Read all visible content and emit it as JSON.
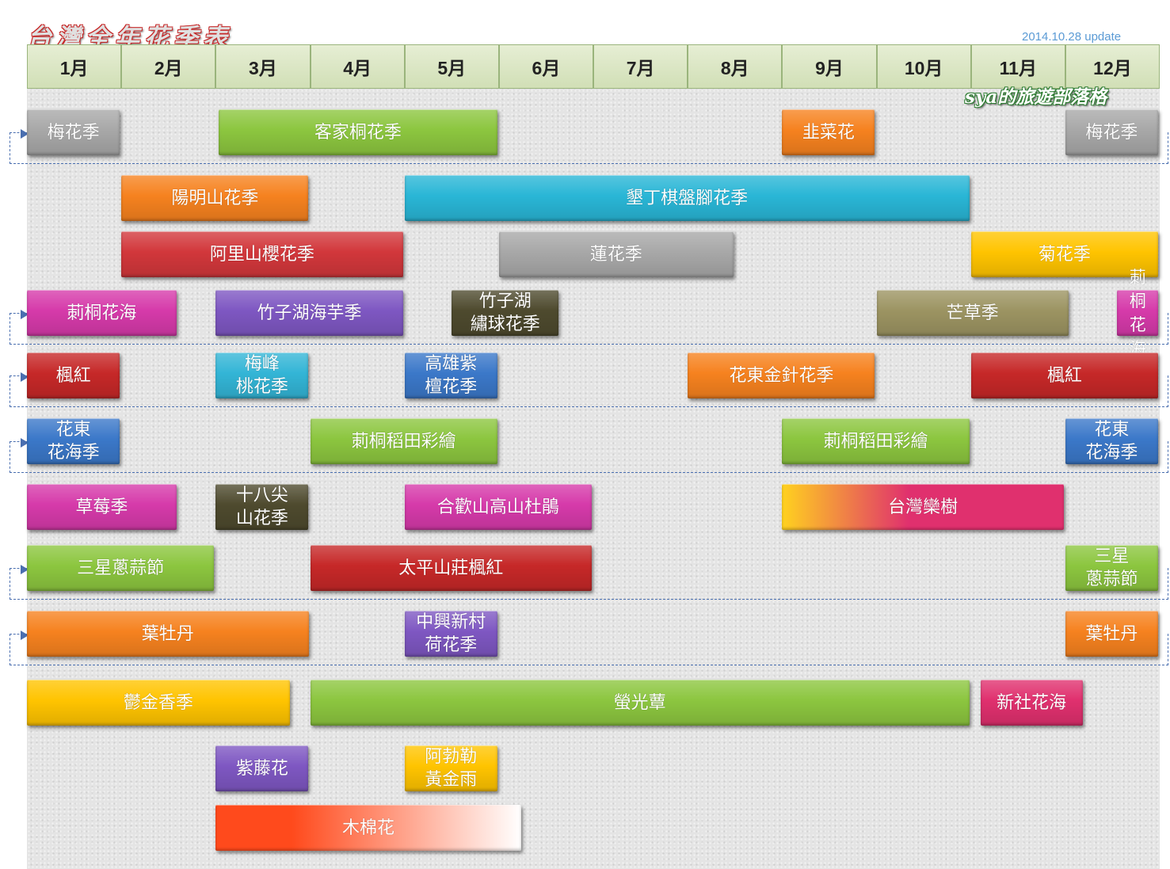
{
  "header": {
    "title": "台灣全年花季表",
    "update": "2014.10.28 update",
    "author": "sya的旅遊部落格"
  },
  "chart_data": {
    "type": "gantt",
    "title": "台灣全年花季表",
    "months": [
      "1月",
      "2月",
      "3月",
      "4月",
      "5月",
      "6月",
      "7月",
      "8月",
      "9月",
      "10月",
      "11月",
      "12月"
    ],
    "x_range": [
      1,
      13
    ],
    "rows": [
      {
        "row": 1,
        "wraps_year": true,
        "bars": [
          {
            "label": "梅花季",
            "start": 1.0,
            "end": 2.0,
            "color": "#a8a8a8"
          },
          {
            "label": "客家桐花季",
            "start": 3.03,
            "end": 6.0,
            "color": "#8cc63f"
          },
          {
            "label": "韭菜花",
            "start": 9.0,
            "end": 10.0,
            "color": "#f6821f"
          },
          {
            "label": "梅花季",
            "start": 12.0,
            "end": 13.0,
            "color": "#a8a8a8"
          }
        ]
      },
      {
        "row": 2,
        "wraps_year": false,
        "bars": [
          {
            "label": "陽明山花季",
            "start": 2.0,
            "end": 4.0,
            "color": "#f6821f"
          },
          {
            "label": "墾丁棋盤腳花季",
            "start": 5.0,
            "end": 11.0,
            "color": "#29b6d6"
          }
        ]
      },
      {
        "row": 3,
        "wraps_year": false,
        "bars": [
          {
            "label": "阿里山櫻花季",
            "start": 2.0,
            "end": 5.0,
            "color": "#d2373b"
          },
          {
            "label": "蓮花季",
            "start": 6.0,
            "end": 8.5,
            "color": "#a8a8a8"
          },
          {
            "label": "菊花季",
            "start": 11.0,
            "end": 13.0,
            "color": "#ffc400"
          }
        ]
      },
      {
        "row": 4,
        "wraps_year": true,
        "bars": [
          {
            "label": "莿桐花海",
            "start": 1.0,
            "end": 2.6,
            "color": "#d63aaa"
          },
          {
            "label": "竹子湖海芋季",
            "start": 3.0,
            "end": 5.0,
            "color": "#7e57c2"
          },
          {
            "label": "竹子湖\n繡球花季",
            "start": 5.5,
            "end": 6.65,
            "color": "#4e4a2e"
          },
          {
            "label": "芒草季",
            "start": 10.0,
            "end": 12.05,
            "color": "#9c9462"
          },
          {
            "label": "莿\n桐\n花\n海",
            "start": 12.55,
            "end": 13.0,
            "color": "#d63aaa",
            "vertical": true
          }
        ]
      },
      {
        "row": 5,
        "wraps_year": true,
        "bars": [
          {
            "label": "楓紅",
            "start": 1.0,
            "end": 2.0,
            "color": "#c62828"
          },
          {
            "label": "梅峰\n桃花季",
            "start": 3.0,
            "end": 4.0,
            "color": "#33b5d6"
          },
          {
            "label": "高雄紫\n檀花季",
            "start": 5.0,
            "end": 6.0,
            "color": "#3b78c9"
          },
          {
            "label": "花東金針花季",
            "start": 8.0,
            "end": 10.0,
            "color": "#f6821f"
          },
          {
            "label": "楓紅",
            "start": 11.0,
            "end": 13.0,
            "color": "#c62828"
          }
        ]
      },
      {
        "row": 6,
        "wraps_year": true,
        "bars": [
          {
            "label": "花東\n花海季",
            "start": 1.0,
            "end": 2.0,
            "color": "#3b78c9"
          },
          {
            "label": "莿桐稻田彩繪",
            "start": 4.0,
            "end": 6.0,
            "color": "#8cc63f"
          },
          {
            "label": "莿桐稻田彩繪",
            "start": 9.0,
            "end": 11.0,
            "color": "#8cc63f"
          },
          {
            "label": "花東\n花海季",
            "start": 12.0,
            "end": 13.0,
            "color": "#3b78c9"
          }
        ]
      },
      {
        "row": 7,
        "wraps_year": false,
        "bars": [
          {
            "label": "草莓季",
            "start": 1.0,
            "end": 2.6,
            "color": "#d63aaa"
          },
          {
            "label": "十八尖\n山花季",
            "start": 3.0,
            "end": 4.0,
            "color": "#4e4a2e"
          },
          {
            "label": "合歡山高山杜鵑",
            "start": 5.0,
            "end": 7.0,
            "color": "#d63aaa"
          },
          {
            "label": "台灣欒樹",
            "start": 9.0,
            "end": 12.0,
            "color": "#e0306e",
            "gradient_from": "#ffd21f"
          }
        ]
      },
      {
        "row": 8,
        "wraps_year": true,
        "bars": [
          {
            "label": "三星蔥蒜節",
            "start": 1.0,
            "end": 3.0,
            "color": "#8cc63f"
          },
          {
            "label": "太平山莊楓紅",
            "start": 4.0,
            "end": 7.0,
            "color": "#c62828"
          },
          {
            "label": "三星\n蔥蒜節",
            "start": 12.0,
            "end": 13.0,
            "color": "#8cc63f"
          }
        ]
      },
      {
        "row": 9,
        "wraps_year": true,
        "bars": [
          {
            "label": "葉牡丹",
            "start": 1.0,
            "end": 4.0,
            "color": "#f6821f"
          },
          {
            "label": "中興新村\n荷花季",
            "start": 5.0,
            "end": 6.0,
            "color": "#7e57c2"
          },
          {
            "label": "葉牡丹",
            "start": 12.0,
            "end": 13.0,
            "color": "#f6821f"
          }
        ]
      },
      {
        "row": 10,
        "wraps_year": false,
        "bars": [
          {
            "label": "鬱金香季",
            "start": 1.0,
            "end": 3.8,
            "color": "#ffc400"
          },
          {
            "label": "螢光蕈",
            "start": 4.0,
            "end": 11.0,
            "color": "#8cc63f"
          },
          {
            "label": "新社花海",
            "start": 11.1,
            "end": 12.2,
            "color": "#e0306e"
          }
        ]
      },
      {
        "row": 11,
        "wraps_year": false,
        "bars": [
          {
            "label": "紫藤花",
            "start": 3.0,
            "end": 4.0,
            "color": "#7e57c2"
          },
          {
            "label": "阿勃勒\n黃金雨",
            "start": 5.0,
            "end": 6.0,
            "color": "#ffc400"
          }
        ]
      },
      {
        "row": 12,
        "wraps_year": false,
        "bars": [
          {
            "label": "木棉花",
            "start": 3.0,
            "end": 6.25,
            "color": "#ff4a1c",
            "gradient_to": "#ffffff"
          }
        ]
      }
    ]
  }
}
